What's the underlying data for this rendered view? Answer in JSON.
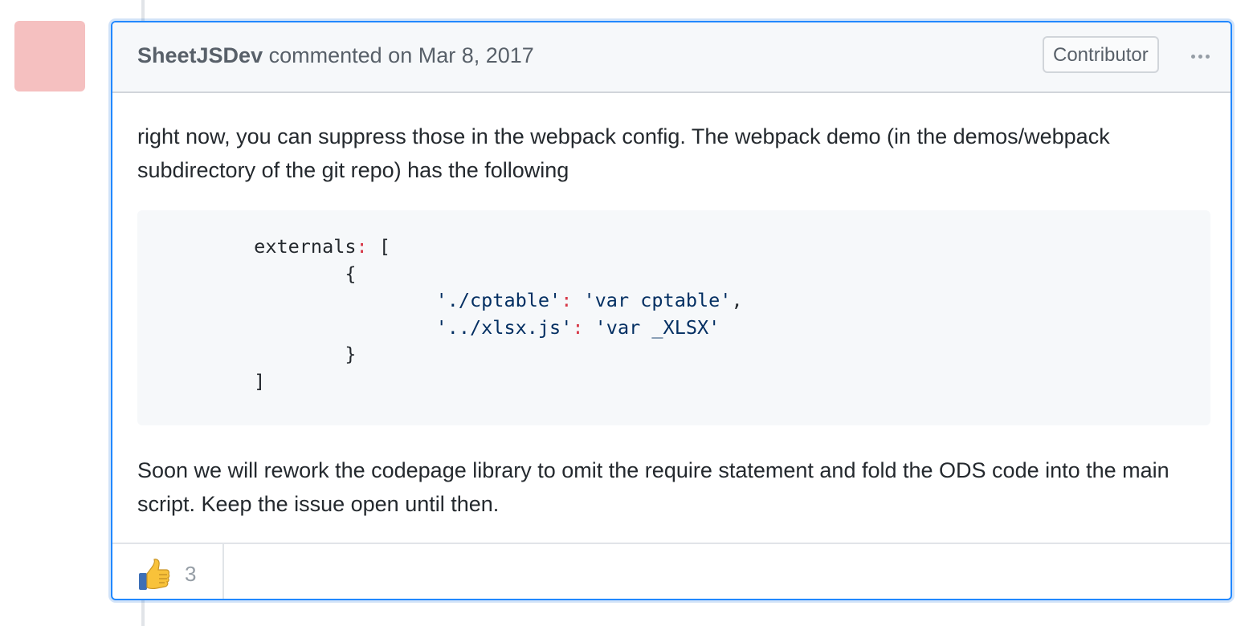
{
  "comment": {
    "author": "SheetJSDev",
    "action": "commented on",
    "date": "Mar 8, 2017",
    "role_badge": "Contributor",
    "menu_icon": "kebab-horizontal-icon",
    "body": {
      "paragraph1": "right now, you can suppress those in the webpack config. The webpack demo (in the demos/webpack subdirectory of the git repo) has the following",
      "code_lines": [
        "externals: [",
        "{",
        "'./cptable': 'var cptable',",
        "'../xlsx.js': 'var _XLSX'",
        "}",
        "]"
      ],
      "paragraph2": "Soon we will rework the codepage library to omit the require statement and fold the ODS code into the main script. Keep the issue open until then."
    },
    "reactions": [
      {
        "emoji": "thumbs-up-icon",
        "count": "3"
      }
    ]
  },
  "colors": {
    "focus_border": "#2188ff",
    "header_bg": "#f6f8fa",
    "code_string": "#032f62",
    "code_punct": "#d73a49",
    "avatar": "#f5c0c0"
  }
}
